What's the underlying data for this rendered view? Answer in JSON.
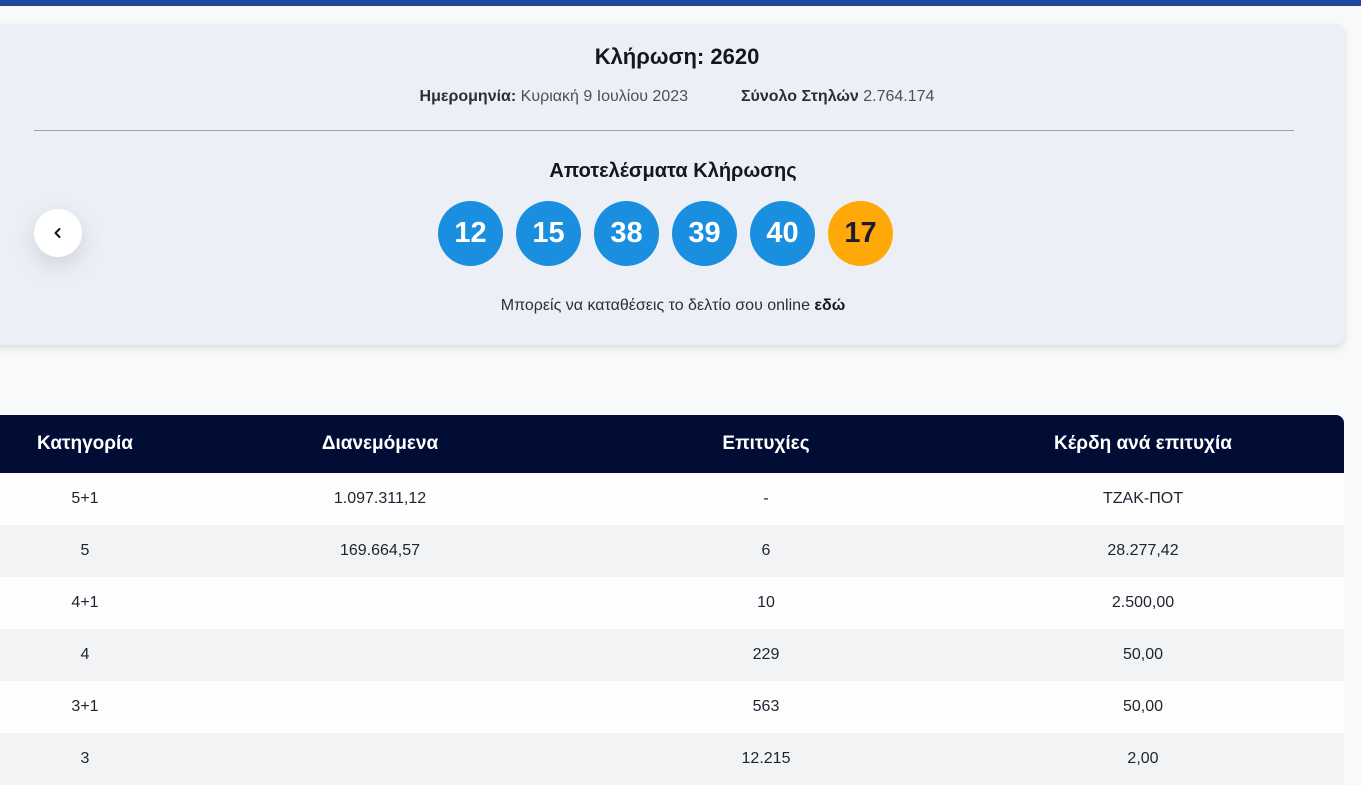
{
  "draw": {
    "title": "Κλήρωση: 2620",
    "date_label": "Ημερομηνία:",
    "date_value": "Κυριακή 9 Ιουλίου 2023",
    "columns_label": "Σύνολο Στηλών",
    "columns_value": "2.764.174",
    "results_title": "Αποτελέσματα Κλήρωσης",
    "numbers": [
      "12",
      "15",
      "38",
      "39",
      "40"
    ],
    "bonus": "17",
    "online_text": "Μπορείς να καταθέσεις το δελτίο σου online",
    "online_link": "εδώ"
  },
  "colors": {
    "top_bar": "#1e4a9a",
    "ball": "#1a8fe0",
    "bonus_ball": "#ffa909",
    "table_header": "#020d36"
  },
  "icons": {
    "prev": "chevron-left-icon"
  },
  "table": {
    "headers": [
      "Κατηγορία",
      "Διανεμόμενα",
      "Επιτυχίες",
      "Κέρδη ανά επιτυχία"
    ],
    "rows": [
      [
        "5+1",
        "1.097.311,12",
        "-",
        "ΤΖΑΚ-ΠΟΤ"
      ],
      [
        "5",
        "169.664,57",
        "6",
        "28.277,42"
      ],
      [
        "4+1",
        "",
        "10",
        "2.500,00"
      ],
      [
        "4",
        "",
        "229",
        "50,00"
      ],
      [
        "3+1",
        "",
        "563",
        "50,00"
      ],
      [
        "3",
        "",
        "12.215",
        "2,00"
      ]
    ]
  }
}
